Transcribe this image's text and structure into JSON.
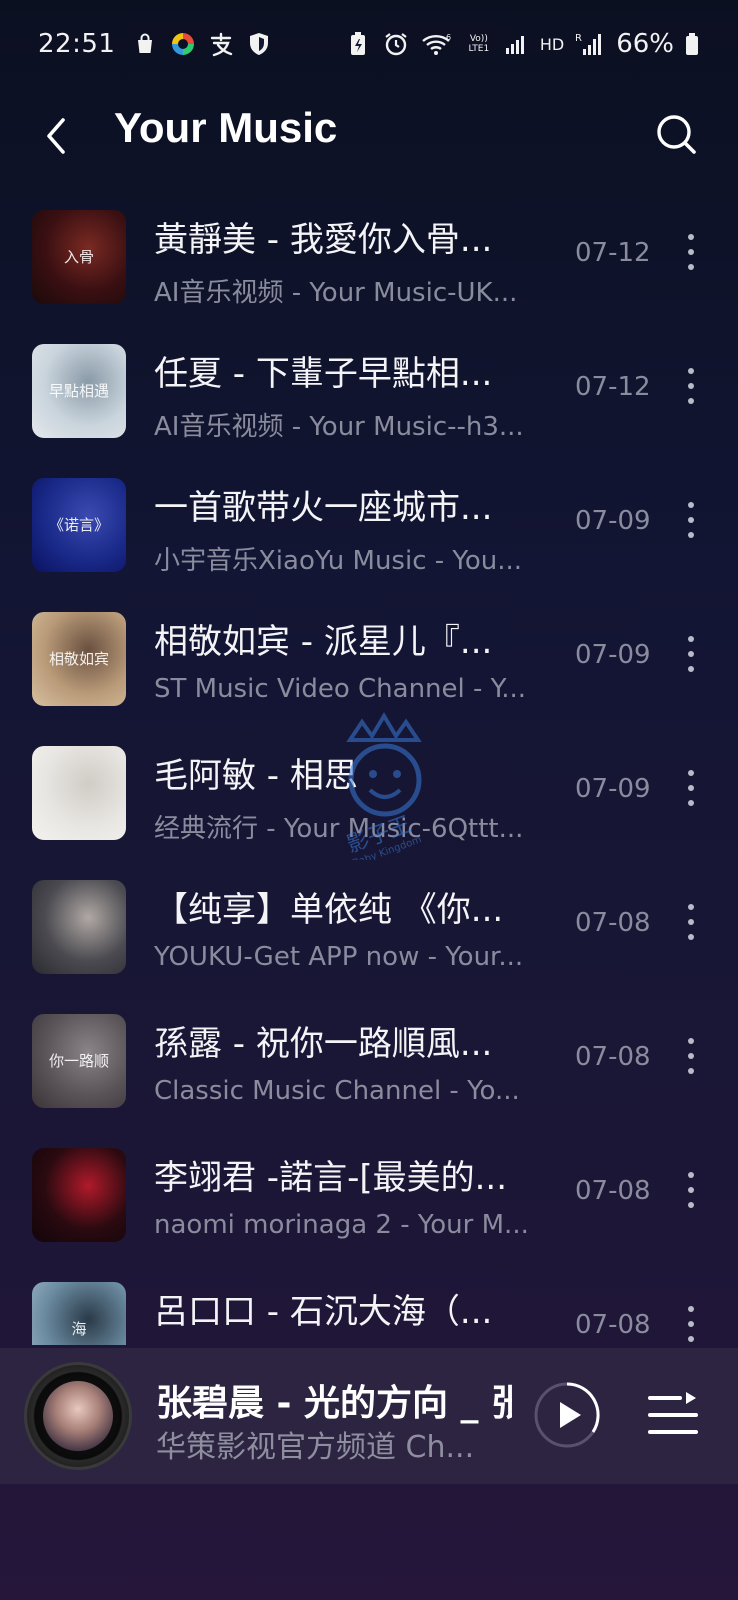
{
  "status_bar": {
    "time": "22:51",
    "network_label_volte": "Vo)) LTE1",
    "hd_label": "HD",
    "battery": "66%",
    "icons": [
      "shopping-bag-icon",
      "colorful-app-icon",
      "alipay-icon",
      "shield-icon",
      "battery-saver-icon",
      "alarm-icon",
      "wifi-icon",
      "signal-icon",
      "signal-roaming-icon",
      "battery-icon"
    ]
  },
  "header": {
    "title": "Your Music",
    "back_icon": "chevron-left-icon",
    "search_icon": "search-icon"
  },
  "songs": [
    {
      "title": "黃靜美 - 我愛你入骨...",
      "subtitle": "AI音乐视频 - Your Music-UK...",
      "date": "07-12",
      "thumb_text": "入骨",
      "thumb_colors": [
        "#3a0f12",
        "#7a2a22",
        "#1a0a0a"
      ]
    },
    {
      "title": "任夏 - 下輩子早點相...",
      "subtitle": "AI音乐视频 - Your Music--h3...",
      "date": "07-12",
      "thumb_text": "早點相遇",
      "thumb_colors": [
        "#c9d4dc",
        "#8a9aa8",
        "#e4e8ec"
      ]
    },
    {
      "title": "一首歌带火一座城市...",
      "subtitle": "小宇音乐XiaoYu Music - You...",
      "date": "07-09",
      "thumb_text": "《诺言》",
      "thumb_colors": [
        "#1a2a8a",
        "#3a4ab0",
        "#0a1260"
      ]
    },
    {
      "title": "相敬如宾 - 派星儿『...",
      "subtitle": "ST Music Video Channel - Y...",
      "date": "07-09",
      "thumb_text": "相敬如宾",
      "thumb_colors": [
        "#b89a78",
        "#6a5040",
        "#d8c0a0"
      ]
    },
    {
      "title": "毛阿敏 - 相思",
      "subtitle": "经典流行 - Your Music-6Qttt...",
      "date": "07-09",
      "thumb_text": "",
      "thumb_colors": [
        "#e8e6e2",
        "#d0ccc6",
        "#f4f2ee"
      ]
    },
    {
      "title": "【纯享】单依纯 《你...",
      "subtitle": "YOUKU-Get APP now - Your...",
      "date": "07-08",
      "thumb_text": "",
      "thumb_colors": [
        "#4a4a50",
        "#b0a8a4",
        "#2a2a30"
      ]
    },
    {
      "title": "孫露 - 祝你一路順風...",
      "subtitle": "Classic Music Channel - Yo...",
      "date": "07-08",
      "thumb_text": "你一路顺",
      "thumb_colors": [
        "#5a5458",
        "#8a8488",
        "#3a3438"
      ]
    },
    {
      "title": "李翊君  -諾言-[最美的...",
      "subtitle": "naomi morinaga 2 - Your M...",
      "date": "07-08",
      "thumb_text": "",
      "thumb_colors": [
        "#2a0a10",
        "#b01a2a",
        "#10050a"
      ]
    },
    {
      "title": "呂口口 - 石沉大海（...",
      "subtitle": "",
      "date": "07-08",
      "thumb_text": "海",
      "thumb_colors": [
        "#6a8aa0",
        "#2a3a48",
        "#a0b8c8"
      ]
    }
  ],
  "watermark": {
    "label": "影子王",
    "sub": "Baby Kingdom"
  },
  "now_playing": {
    "title": "张碧晨 - 光的方向 _ 张",
    "subtitle": "华策影视官方频道 Ch...",
    "play_icon": "play-icon",
    "queue_icon": "playlist-icon"
  }
}
